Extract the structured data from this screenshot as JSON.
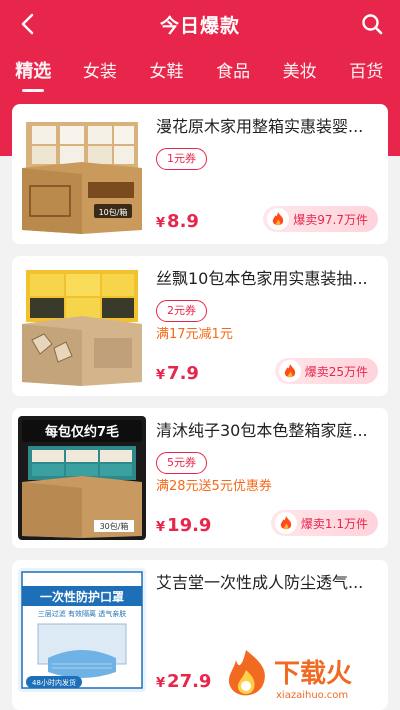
{
  "header": {
    "title": "今日爆款",
    "back_icon": "chevron-left-icon",
    "search_icon": "search-icon",
    "accent": "#e8264b"
  },
  "tabs": [
    {
      "label": "精选",
      "active": true
    },
    {
      "label": "女装",
      "active": false
    },
    {
      "label": "女鞋",
      "active": false
    },
    {
      "label": "食品",
      "active": false
    },
    {
      "label": "美妆",
      "active": false
    },
    {
      "label": "百货",
      "active": false
    }
  ],
  "products": [
    {
      "title": "漫花原木家用整箱实惠装婴...",
      "coupon": "1元券",
      "promo": "",
      "price_symbol": "¥",
      "price": "8.9",
      "hot": "爆卖97.7万件",
      "image_text": "10包/箱"
    },
    {
      "title": "丝飘10包本色家用实惠装抽...",
      "coupon": "2元券",
      "promo": "满17元减1元",
      "price_symbol": "¥",
      "price": "7.9",
      "hot": "爆卖25万件",
      "image_text": ""
    },
    {
      "title": "清沐纯子30包本色整箱家庭...",
      "coupon": "5元券",
      "promo": "满28元送5元优惠券",
      "price_symbol": "¥",
      "price": "19.9",
      "hot": "爆卖1.1万件",
      "image_text": "每包仅约7毛",
      "image_text2": "30包/箱"
    },
    {
      "title": "艾吉堂一次性成人防尘透气...",
      "coupon": "",
      "promo": "",
      "price_symbol": "¥",
      "price": "27.9",
      "hot": "",
      "image_text": "一次性防护口罩",
      "image_text2": "三层过滤 有效隔离 透气亲肤",
      "image_text3": "48小时内发货"
    }
  ],
  "watermark": {
    "text": "下载火",
    "subtext": "xiazaihuo.com"
  }
}
